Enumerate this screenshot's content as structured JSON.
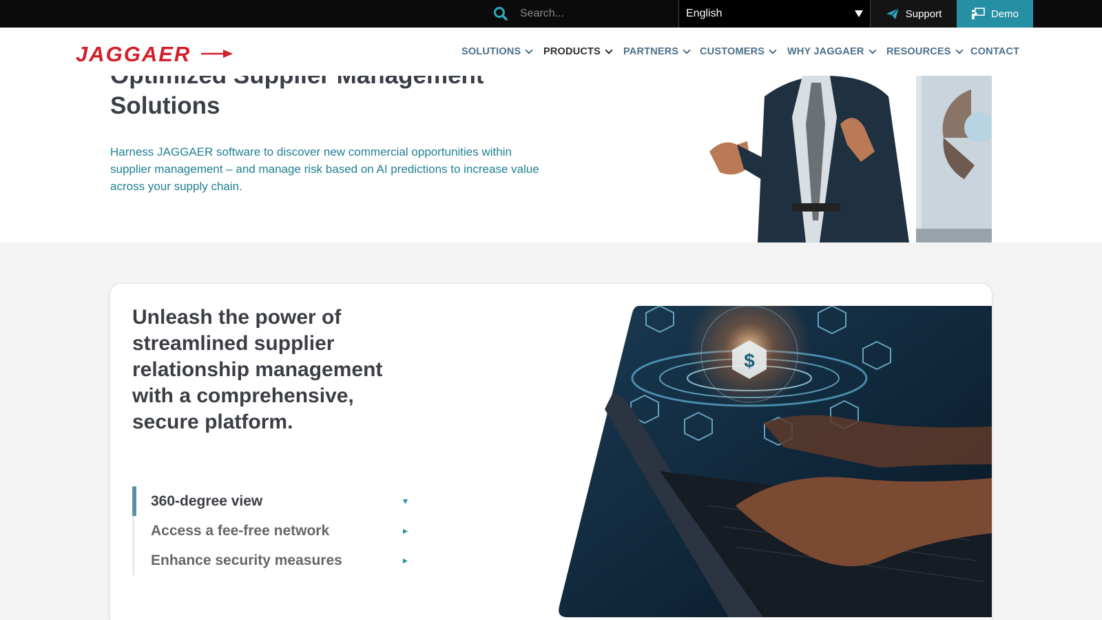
{
  "topbar": {
    "search_placeholder": "Search...",
    "language": "English",
    "support_label": "Support",
    "demo_label": "Demo"
  },
  "brand": {
    "logo_text": "JAGGAER",
    "accent_color": "#d31f2b"
  },
  "nav": {
    "items": [
      {
        "label": "SOLUTIONS",
        "has_dropdown": true
      },
      {
        "label": "PRODUCTS",
        "has_dropdown": true,
        "active": true
      },
      {
        "label": "PARTNERS",
        "has_dropdown": true
      },
      {
        "label": "CUSTOMERS",
        "has_dropdown": true
      },
      {
        "label": "WHY JAGGAER",
        "has_dropdown": true
      },
      {
        "label": "RESOURCES",
        "has_dropdown": true
      },
      {
        "label": "CONTACT",
        "has_dropdown": false
      }
    ]
  },
  "hero": {
    "title_line1": "Optimized Supplier Management",
    "title_line2": "Solutions",
    "description": "Harness JAGGAER software to discover new commercial opportunities within supplier management – and manage risk based on AI predictions to increase value across your supply chain."
  },
  "card": {
    "title": "Unleash the power of streamlined supplier relationship management with a comprehensive, secure platform.",
    "accordion": [
      {
        "label": "360-degree view",
        "open": true,
        "arrow": "▾"
      },
      {
        "label": "Access a fee-free network",
        "open": false,
        "arrow": "▸"
      },
      {
        "label": "Enhance security measures",
        "open": false,
        "arrow": "▸"
      }
    ]
  },
  "colors": {
    "teal": "#2590a4",
    "nav_text": "#4b6f89",
    "dark_text": "#3b3e44"
  }
}
